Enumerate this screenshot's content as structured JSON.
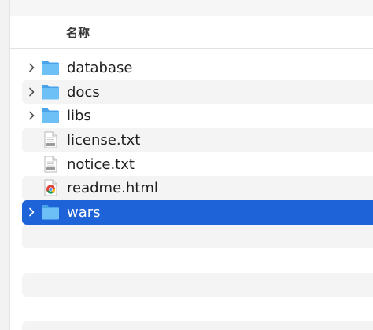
{
  "header": {
    "name_column": "名称"
  },
  "files": [
    {
      "name": "database",
      "type": "folder",
      "expandable": true,
      "selected": false,
      "icon": "folder-icon"
    },
    {
      "name": "docs",
      "type": "folder",
      "expandable": true,
      "selected": false,
      "icon": "folder-icon"
    },
    {
      "name": "libs",
      "type": "folder",
      "expandable": true,
      "selected": false,
      "icon": "folder-icon"
    },
    {
      "name": "license.txt",
      "type": "text",
      "expandable": false,
      "selected": false,
      "icon": "text-file-icon"
    },
    {
      "name": "notice.txt",
      "type": "text",
      "expandable": false,
      "selected": false,
      "icon": "text-file-icon"
    },
    {
      "name": "readme.html",
      "type": "html",
      "expandable": false,
      "selected": false,
      "icon": "chrome-html-icon"
    },
    {
      "name": "wars",
      "type": "folder",
      "expandable": true,
      "selected": true,
      "icon": "folder-icon"
    }
  ],
  "colors": {
    "selection": "#1f63d8",
    "folder": "#5fb4ef",
    "stripe": "#f4f4f4"
  }
}
